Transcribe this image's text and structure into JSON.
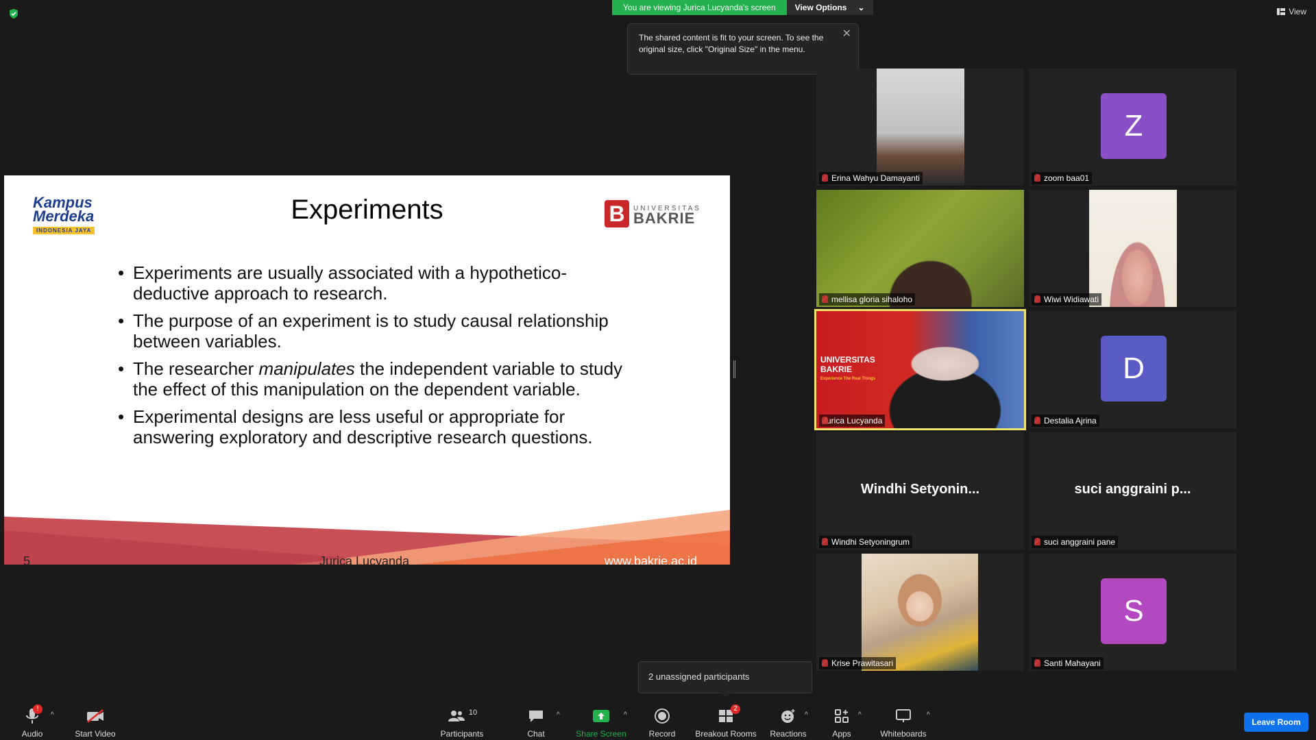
{
  "top": {
    "viewing_banner": "You are viewing Jurica Lucyanda's screen",
    "view_options": "View Options",
    "tooltip_text": "The shared content is fit to your screen. To see the original size, click \"Original Size\" in the menu.",
    "view_label": "View"
  },
  "slide": {
    "title": "Experiments",
    "logo_left": {
      "line1": "Kampus",
      "line2": "Merdeka",
      "line3": "INDONESIA JAYA"
    },
    "logo_right": {
      "line1": "UNIVERSITAS",
      "line2": "BAKRIE",
      "mark": "B"
    },
    "bullets": [
      "Experiments are usually associated with a hypothetico-deductive approach to research.",
      "The purpose of an experiment is to study causal relationship between variables.",
      "the independent variable to study the effect of this manipulation on the dependent variable.",
      "Experimental designs are less useful or appropriate for answering exploratory and descriptive research questions."
    ],
    "bullet3_prefix": "The researcher ",
    "bullet3_emph": "manipulates",
    "footer_num": "5",
    "footer_name": "Jurica Lucyanda",
    "footer_url": "www.bakrie.ac.id"
  },
  "participants": [
    {
      "name": "Erina Wahyu Damayanti",
      "type": "video"
    },
    {
      "name": "zoom baa01",
      "type": "avatar",
      "initial": "Z",
      "color": "#8a4fc7"
    },
    {
      "name": "mellisa gloria sihaloho",
      "type": "video"
    },
    {
      "name": "Wiwi Widiawati",
      "type": "video"
    },
    {
      "name": "Jurica Lucyanda",
      "type": "video",
      "active": true,
      "bg_text1": "UNIVERSITAS",
      "bg_text2": "BAKRIE",
      "bg_text3": "Experience The Real Things"
    },
    {
      "name": "Destalia Ajrina",
      "type": "avatar",
      "initial": "D",
      "color": "#5a5bc4"
    },
    {
      "name": "Windhi Setyoningrum",
      "type": "text",
      "display": "Windhi  Setyonin..."
    },
    {
      "name": "suci anggraini pane",
      "type": "text",
      "display": "suci anggraini p..."
    },
    {
      "name": "Krise Prawitasari",
      "type": "video"
    },
    {
      "name": "Santi Mahayani",
      "type": "avatar",
      "initial": "S",
      "color": "#b249c0"
    }
  ],
  "breakout_popup": "2 unassigned participants",
  "toolbar": {
    "audio": "Audio",
    "audio_badge": "!",
    "start_video": "Start Video",
    "participants": "Participants",
    "participants_count": "10",
    "chat": "Chat",
    "share_screen": "Share Screen",
    "record": "Record",
    "breakout_rooms": "Breakout Rooms",
    "breakout_badge": "2",
    "reactions": "Reactions",
    "apps": "Apps",
    "whiteboards": "Whiteboards",
    "leave_room": "Leave Room"
  },
  "colors": {
    "green": "#22b14c",
    "leave_blue": "#0e72ed",
    "active_border": "#f1e26b",
    "bakrie_red": "#c8282a"
  }
}
